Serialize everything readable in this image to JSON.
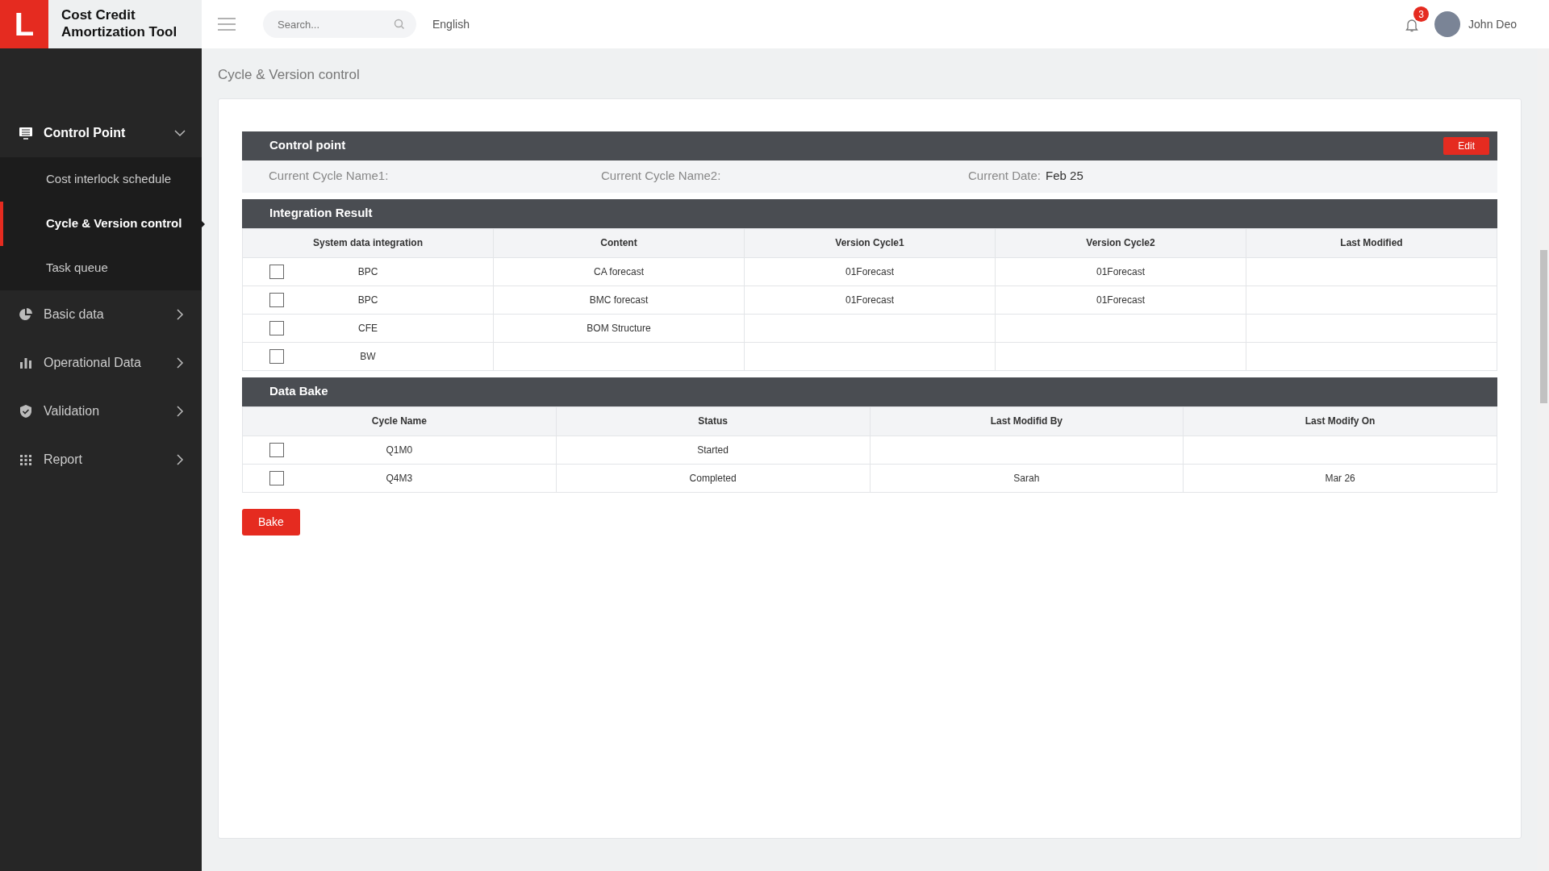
{
  "app": {
    "logo_letter": "L",
    "title": "Cost Credit Amortization Tool"
  },
  "topbar": {
    "search": {
      "placeholder": "Search..."
    },
    "language": "English",
    "notifications": "3",
    "user": "John Deo"
  },
  "sidebar": {
    "items": [
      {
        "label": "Control Point",
        "expanded": true,
        "selected": false,
        "children": [
          {
            "label": "Cost interlock schedule",
            "selected": false
          },
          {
            "label": "Cycle & Version control",
            "selected": true
          },
          {
            "label": "Task queue",
            "selected": false
          }
        ]
      },
      {
        "label": "Basic data",
        "expanded": false,
        "selected": false
      },
      {
        "label": "Operational Data",
        "expanded": false,
        "selected": false
      },
      {
        "label": "Validation",
        "expanded": false,
        "selected": false
      },
      {
        "label": "Report",
        "expanded": false,
        "selected": false
      }
    ]
  },
  "page_title": "Cycle & Version control",
  "control_point": {
    "title": "Control point",
    "edit_button": "Edit",
    "fields": [
      {
        "label": "Current Cycle Name1:"
      },
      {
        "label": "Current Cycle Name2:"
      },
      {
        "label": "Current Date:",
        "value": "Feb 25"
      }
    ]
  },
  "integration_result": {
    "title": "Integration Result",
    "columns": [
      "System data integration",
      "Content",
      "Version Cycle1",
      "Version Cycle2",
      "Last Modified"
    ],
    "rows": [
      {
        "checked": false,
        "cells": [
          "BPC",
          "CA forecast",
          "01Forecast",
          "01Forecast",
          ""
        ]
      },
      {
        "checked": false,
        "cells": [
          "BPC",
          "BMC forecast",
          "01Forecast",
          "01Forecast",
          ""
        ]
      },
      {
        "checked": false,
        "cells": [
          "CFE",
          "BOM Structure",
          "",
          "",
          ""
        ]
      },
      {
        "checked": false,
        "cells": [
          "BW",
          "",
          "",
          "",
          ""
        ]
      }
    ]
  },
  "data_bake": {
    "title": "Data Bake",
    "columns": [
      "Cycle Name",
      "Status",
      "Last Modifid By",
      "Last Modify On"
    ],
    "rows": [
      {
        "checked": false,
        "cells": [
          "Q1M0",
          "Started",
          "",
          ""
        ]
      },
      {
        "checked": false,
        "cells": [
          "Q4M3",
          "Completed",
          "Sarah",
          "Mar 26"
        ]
      }
    ],
    "button": "Bake"
  }
}
